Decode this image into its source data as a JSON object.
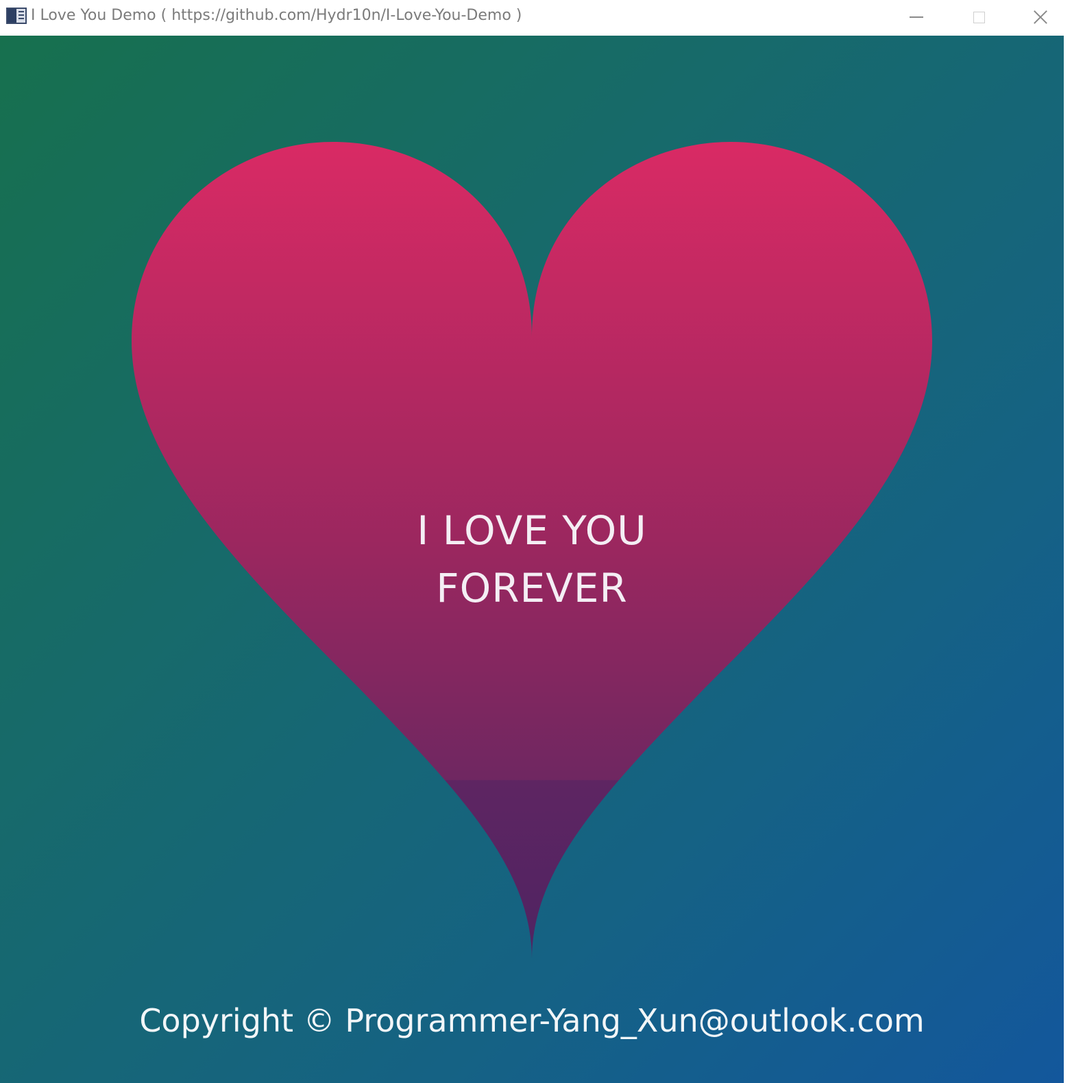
{
  "window": {
    "title": "I Love You Demo ( https://github.com/Hydr10n/I-Love-You-Demo )",
    "controls": {
      "minimize_icon": "minimize-icon",
      "maximize_icon": "maximize-icon",
      "close_icon": "close-icon"
    }
  },
  "heart": {
    "line1": "I LOVE YOU",
    "line2": "FOREVER",
    "colors": {
      "top": "#d92a64",
      "bottom": "#4f2462"
    }
  },
  "footer": {
    "copyright": "Copyright © Programmer-Yang_Xun@outlook.com"
  },
  "background": {
    "gradient_start": "#17704e",
    "gradient_end": "#13579c"
  }
}
